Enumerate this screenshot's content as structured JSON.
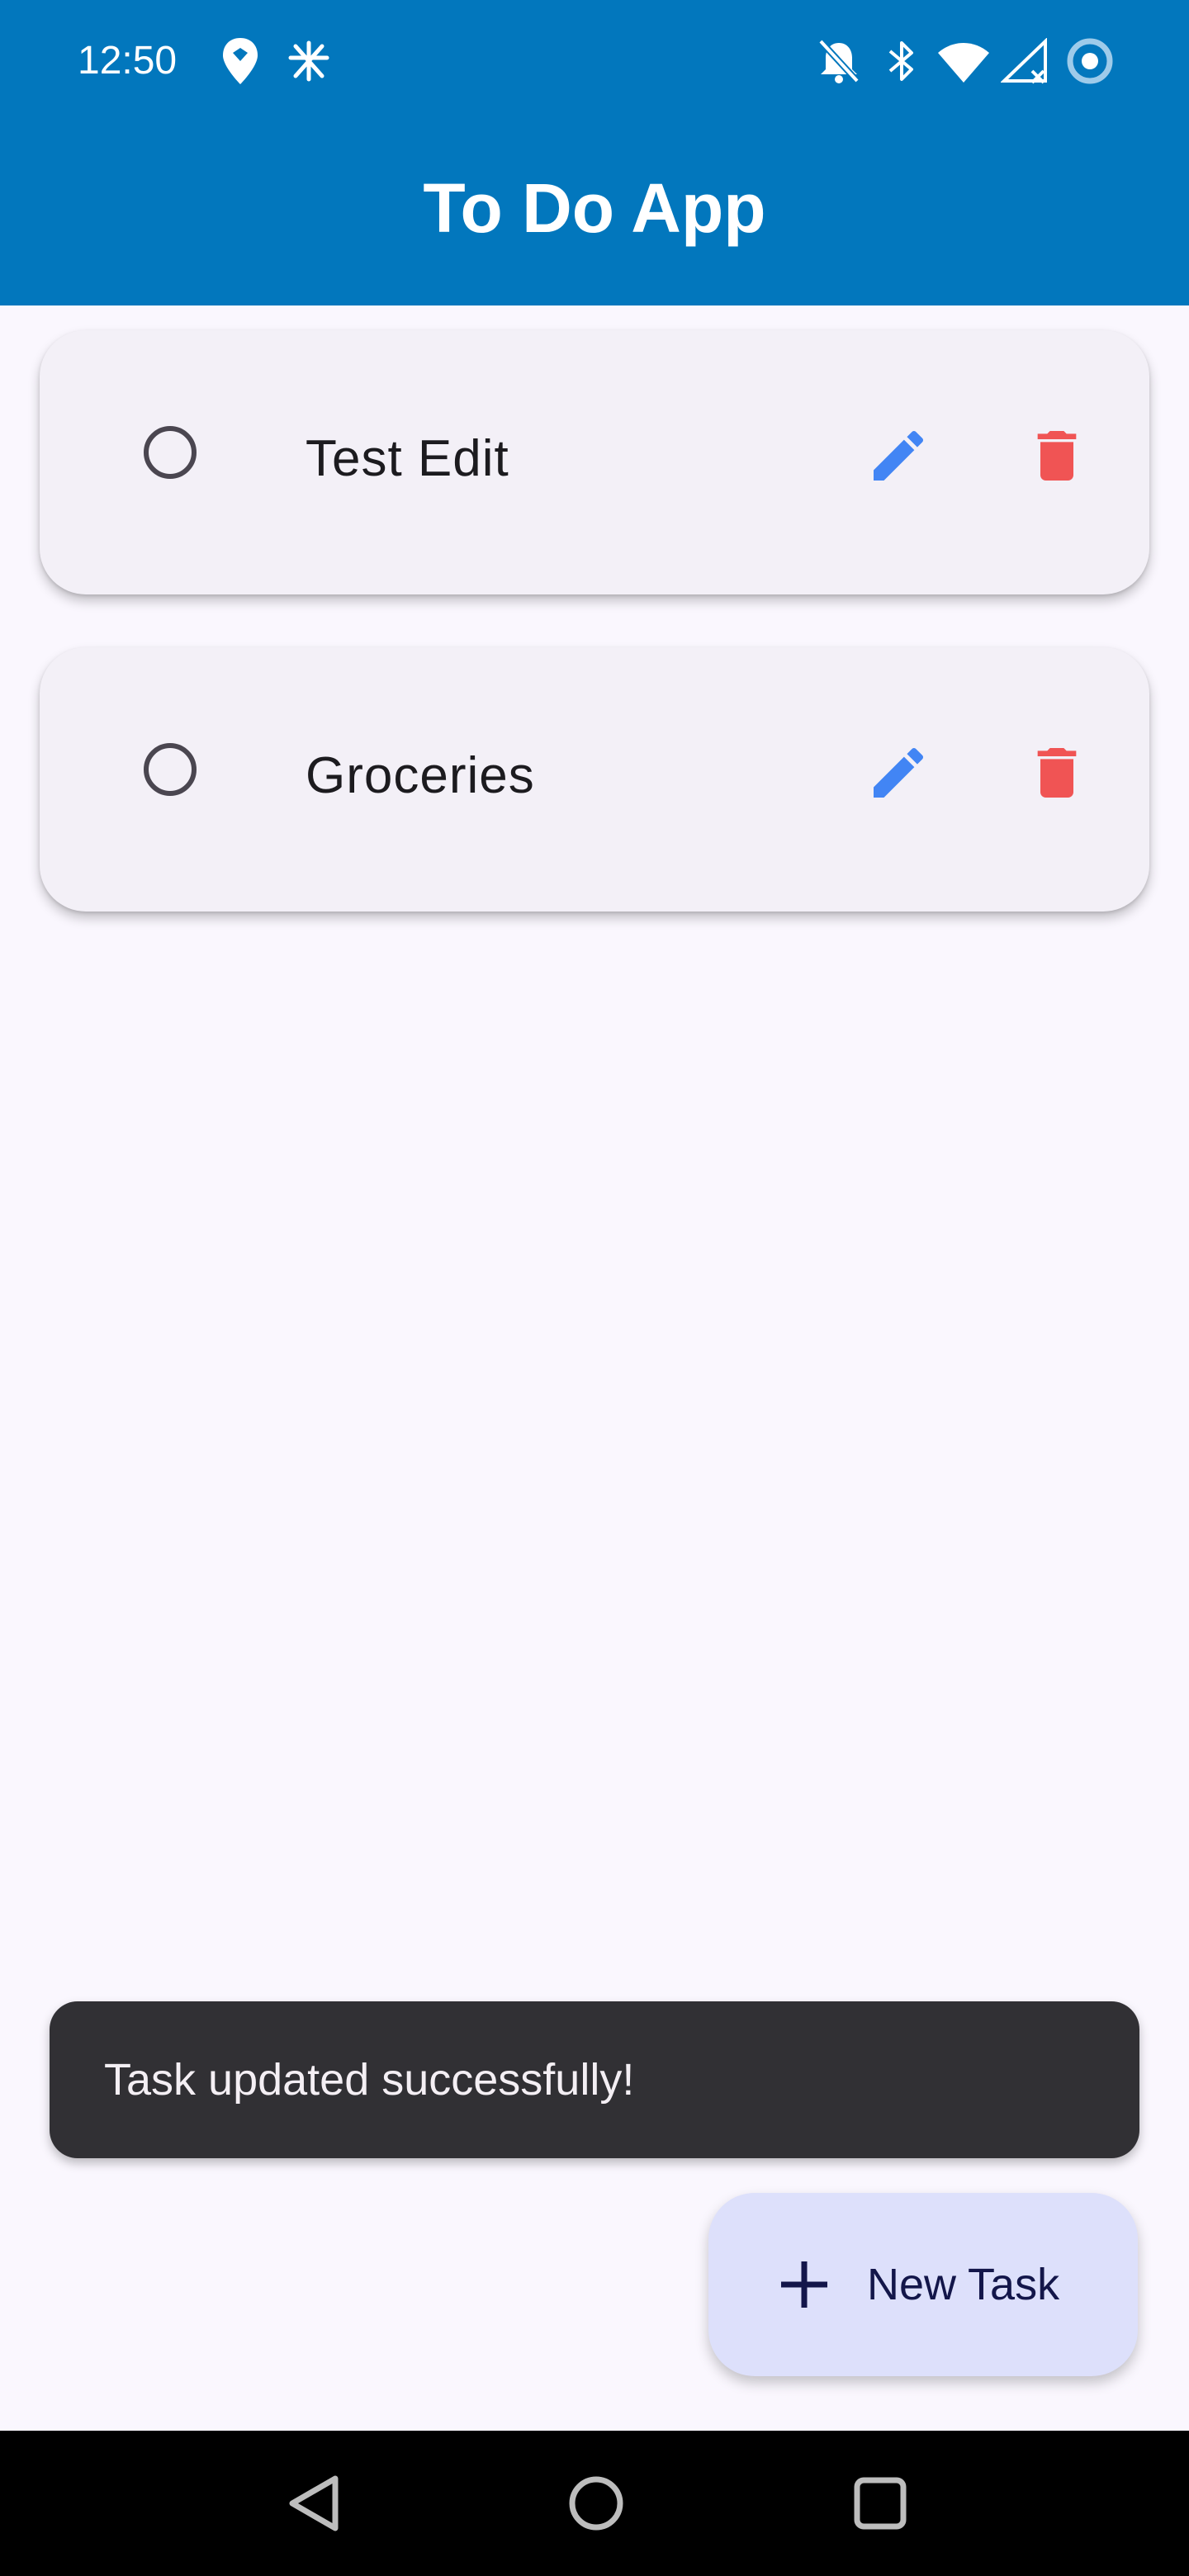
{
  "status_bar": {
    "time": "12:50",
    "left_icons": [
      "maps-icon",
      "sparkle-icon"
    ],
    "right_icons": [
      "bell-off-icon",
      "bluetooth-icon",
      "wifi-icon",
      "signal-icon",
      "data-saver-icon"
    ]
  },
  "app_bar": {
    "title": "To Do App",
    "background": "#0277BD"
  },
  "tasks": [
    {
      "title": "Test Edit",
      "completed": false
    },
    {
      "title": "Groceries",
      "completed": false
    }
  ],
  "snackbar": {
    "message": "Task updated successfully!"
  },
  "fab": {
    "icon": "plus-icon",
    "label": "New Task"
  },
  "colors": {
    "edit_icon": "#4285F4",
    "delete_icon": "#F05454",
    "card_background": "#F3F0F7",
    "page_background": "#FAF7FE",
    "snackbar_background": "#313034",
    "fab_background": "#DDE0FB"
  },
  "nav_bar": {
    "buttons": [
      "back-icon",
      "home-icon",
      "recents-icon"
    ]
  }
}
